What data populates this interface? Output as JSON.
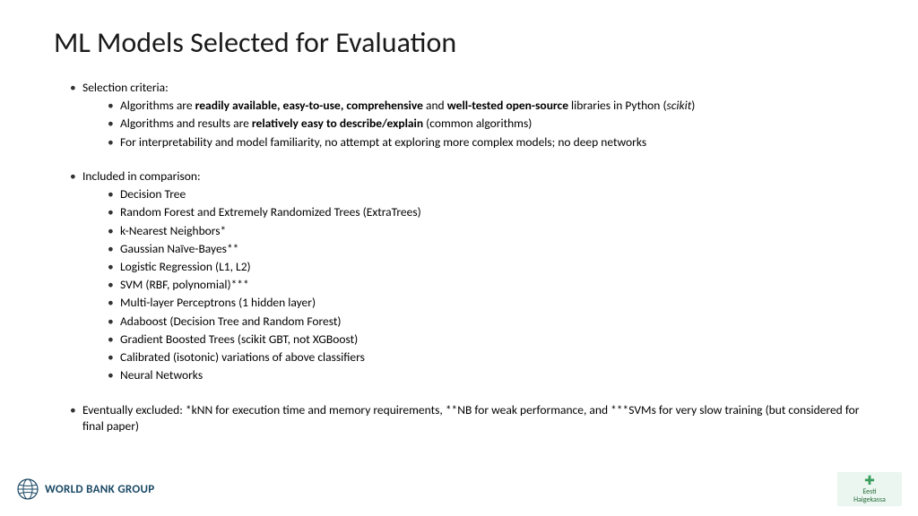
{
  "title": "ML Models Selected for Evaluation",
  "section1": {
    "heading": "Selection criteria:",
    "b1_pre": "Algorithms are ",
    "b1_bold1": "readily available, easy-to-use, comprehensive",
    "b1_mid": " and ",
    "b1_bold2": "well-tested open-source",
    "b1_post1": " libraries in Python (",
    "b1_ital": "scikit",
    "b1_post2": ")",
    "b2_pre": "Algorithms and results are ",
    "b2_bold": "relatively easy to describe/explain",
    "b2_post": " (common algorithms)",
    "b3": "For interpretability and model familiarity, no attempt at exploring more complex models; no deep networks"
  },
  "section2": {
    "heading": "Included in comparison:",
    "items": {
      "i0": "Decision Tree",
      "i1": "Random Forest and Extremely Randomized Trees (ExtraTrees)",
      "i2": "k-Nearest Neighbors*",
      "i3": "Gaussian Naïve-Bayes**",
      "i4": "Logistic Regression (L1, L2)",
      "i5": "SVM (RBF, polynomial)***",
      "i6": "Multi-layer Perceptrons (1 hidden layer)",
      "i7": "Adaboost (Decision Tree and Random Forest)",
      "i8": "Gradient Boosted Trees (scikit GBT, not XGBoost)",
      "i9": "Calibrated (isotonic) variations of above classifiers",
      "i10": "Neural Networks"
    }
  },
  "excluded": "Eventually excluded: *kNN for execution time and memory requirements, **NB for weak performance, and ***SVMs for very slow training (but considered for final paper)",
  "footer": {
    "left_org": "WORLD BANK GROUP",
    "right_line1": "Eesti",
    "right_line2": "Haigekassa"
  }
}
